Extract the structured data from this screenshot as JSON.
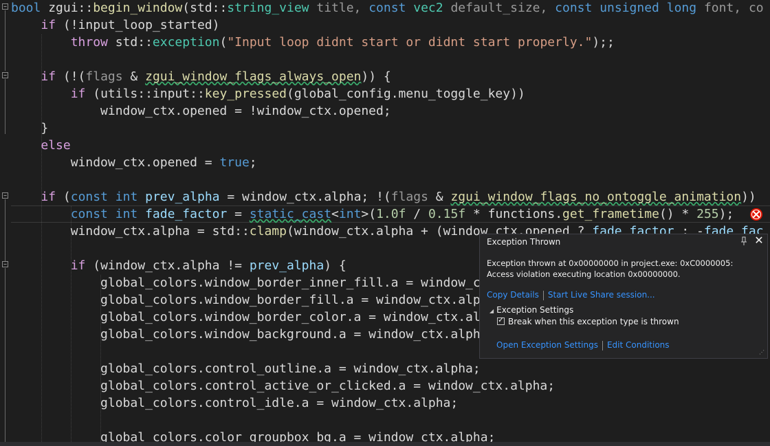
{
  "code_lines": [
    {
      "segs": [
        {
          "t": "bool",
          "c": "kw"
        },
        {
          "t": " zgui::",
          "c": "mem"
        },
        {
          "t": "begin_window",
          "c": "fn"
        },
        {
          "t": "(std::",
          "c": "mem"
        },
        {
          "t": "string_view",
          "c": "ty"
        },
        {
          "t": " title, ",
          "c": "param"
        },
        {
          "t": "const",
          "c": "kw"
        },
        {
          "t": " ",
          "c": "mem"
        },
        {
          "t": "vec2",
          "c": "ty"
        },
        {
          "t": " default_size, ",
          "c": "param"
        },
        {
          "t": "const",
          "c": "kw"
        },
        {
          "t": " ",
          "c": "mem"
        },
        {
          "t": "unsigned",
          "c": "kw"
        },
        {
          "t": " ",
          "c": "mem"
        },
        {
          "t": "long",
          "c": "kw"
        },
        {
          "t": " font, co",
          "c": "param"
        }
      ]
    },
    {
      "segs": [
        {
          "t": "    ",
          "c": "mem"
        },
        {
          "t": "if",
          "c": "ctl"
        },
        {
          "t": " (!input_loop_started)",
          "c": "mem"
        }
      ]
    },
    {
      "segs": [
        {
          "t": "        ",
          "c": "mem"
        },
        {
          "t": "throw",
          "c": "ctl"
        },
        {
          "t": " std::",
          "c": "mem"
        },
        {
          "t": "exception",
          "c": "ty"
        },
        {
          "t": "(",
          "c": "mem"
        },
        {
          "t": "\"Input loop didnt start or didnt start properly.\"",
          "c": "str"
        },
        {
          "t": ");;",
          "c": "mem"
        }
      ]
    },
    {
      "segs": [
        {
          "t": "",
          "c": "mem"
        }
      ]
    },
    {
      "segs": [
        {
          "t": "    ",
          "c": "mem"
        },
        {
          "t": "if",
          "c": "ctl"
        },
        {
          "t": " (!(",
          "c": "mem"
        },
        {
          "t": "flags",
          "c": "param"
        },
        {
          "t": " & ",
          "c": "mem"
        },
        {
          "t": "zgui_window_flags_always_open",
          "c": "fn",
          "u": 1
        },
        {
          "t": ")) {",
          "c": "mem"
        }
      ]
    },
    {
      "segs": [
        {
          "t": "        ",
          "c": "mem"
        },
        {
          "t": "if",
          "c": "ctl"
        },
        {
          "t": " (utils::input::",
          "c": "mem"
        },
        {
          "t": "key_pressed",
          "c": "fn"
        },
        {
          "t": "(global_config.menu_toggle_key))",
          "c": "mem"
        }
      ]
    },
    {
      "segs": [
        {
          "t": "            window_ctx.opened = !window_ctx.opened;",
          "c": "mem"
        }
      ]
    },
    {
      "segs": [
        {
          "t": "    }",
          "c": "mem"
        }
      ]
    },
    {
      "segs": [
        {
          "t": "    ",
          "c": "mem"
        },
        {
          "t": "else",
          "c": "ctl"
        }
      ]
    },
    {
      "segs": [
        {
          "t": "        window_ctx.opened = ",
          "c": "mem"
        },
        {
          "t": "true",
          "c": "kw"
        },
        {
          "t": ";",
          "c": "mem"
        }
      ]
    },
    {
      "segs": [
        {
          "t": "",
          "c": "mem"
        }
      ]
    },
    {
      "segs": [
        {
          "t": "    ",
          "c": "mem"
        },
        {
          "t": "if",
          "c": "ctl"
        },
        {
          "t": " (",
          "c": "mem"
        },
        {
          "t": "const",
          "c": "kw"
        },
        {
          "t": " ",
          "c": "mem"
        },
        {
          "t": "int",
          "c": "kw"
        },
        {
          "t": " ",
          "c": "mem"
        },
        {
          "t": "prev_alpha",
          "c": "var"
        },
        {
          "t": " = window_ctx.alpha; !(",
          "c": "mem"
        },
        {
          "t": "flags",
          "c": "param"
        },
        {
          "t": " & ",
          "c": "mem"
        },
        {
          "t": "zgui_window_flags_no_ontoggle_animation",
          "c": "fn",
          "u": 1
        },
        {
          "t": "))",
          "c": "mem"
        }
      ]
    },
    {
      "segs": [
        {
          "t": "        ",
          "c": "mem"
        },
        {
          "t": "const",
          "c": "kw"
        },
        {
          "t": " ",
          "c": "mem"
        },
        {
          "t": "int",
          "c": "kw"
        },
        {
          "t": " ",
          "c": "mem"
        },
        {
          "t": "fade_factor",
          "c": "var"
        },
        {
          "t": " = ",
          "c": "mem"
        },
        {
          "t": "static_cast",
          "c": "kw",
          "u": 1
        },
        {
          "t": "<",
          "c": "mem"
        },
        {
          "t": "int",
          "c": "kw"
        },
        {
          "t": ">(",
          "c": "mem"
        },
        {
          "t": "1.0f",
          "c": "num"
        },
        {
          "t": " / ",
          "c": "mem"
        },
        {
          "t": "0.15f",
          "c": "num"
        },
        {
          "t": " * functions.",
          "c": "mem"
        },
        {
          "t": "get_frametime",
          "c": "fn"
        },
        {
          "t": "() * ",
          "c": "mem"
        },
        {
          "t": "255",
          "c": "num"
        },
        {
          "t": ");",
          "c": "mem"
        }
      ]
    },
    {
      "segs": [
        {
          "t": "        window_ctx.alpha = std::",
          "c": "mem"
        },
        {
          "t": "clamp",
          "c": "fn"
        },
        {
          "t": "(window_ctx.alpha + (window_ctx.opened ? ",
          "c": "mem"
        },
        {
          "t": "fade_factor",
          "c": "var"
        },
        {
          "t": " : -",
          "c": "mem"
        },
        {
          "t": "fade_fac",
          "c": "var"
        }
      ]
    },
    {
      "segs": [
        {
          "t": "",
          "c": "mem"
        }
      ]
    },
    {
      "segs": [
        {
          "t": "        ",
          "c": "mem"
        },
        {
          "t": "if",
          "c": "ctl"
        },
        {
          "t": " (window_ctx.alpha != ",
          "c": "mem"
        },
        {
          "t": "prev_alpha",
          "c": "var"
        },
        {
          "t": ") {",
          "c": "mem"
        }
      ]
    },
    {
      "segs": [
        {
          "t": "            global_colors.window_border_inner_fill.a = window_c",
          "c": "mem"
        }
      ]
    },
    {
      "segs": [
        {
          "t": "            global_colors.window_border_fill.a = window_ctx.alp",
          "c": "mem"
        }
      ]
    },
    {
      "segs": [
        {
          "t": "            global_colors.window_border_color.a = window_ctx.al",
          "c": "mem"
        }
      ]
    },
    {
      "segs": [
        {
          "t": "            global_colors.window_background.a = window_ctx.alph",
          "c": "mem"
        }
      ]
    },
    {
      "segs": [
        {
          "t": "",
          "c": "mem"
        }
      ]
    },
    {
      "segs": [
        {
          "t": "            global_colors.control_outline.a = window_ctx.alpha;",
          "c": "mem"
        }
      ]
    },
    {
      "segs": [
        {
          "t": "            global_colors.control_active_or_clicked.a = window_ctx.alpha;",
          "c": "mem"
        }
      ]
    },
    {
      "segs": [
        {
          "t": "            global_colors.control_idle.a = window_ctx.alpha;",
          "c": "mem"
        }
      ]
    },
    {
      "segs": [
        {
          "t": "",
          "c": "mem"
        }
      ]
    },
    {
      "segs": [
        {
          "t": "            global_colors.color_groupbox_bg.a = window_ctx.alpha;",
          "c": "mem"
        }
      ]
    }
  ],
  "exception_popup": {
    "title": "Exception Thrown",
    "message": "Exception thrown at 0x00000000 in project.exe: 0xC0000005: Access violation executing location 0x00000000.",
    "copy_details": "Copy Details",
    "live_share": "Start Live Share session...",
    "settings_header": "Exception Settings",
    "break_checkbox_label": "Break when this exception type is thrown",
    "break_checked": true,
    "open_settings": "Open Exception Settings",
    "edit_conditions": "Edit Conditions"
  },
  "icons": {
    "fold": "collapse-icon",
    "error": "error-glyph-icon",
    "pin": "pin-icon",
    "close": "close-icon"
  },
  "colors": {
    "background": "#1e1e1e",
    "keyword": "#569cd6",
    "control": "#d8a0df",
    "function": "#dcdcaa",
    "type": "#4ec9b0",
    "string": "#d69d85",
    "number": "#b5cea8",
    "link": "#3794ff",
    "error": "#e51400"
  }
}
